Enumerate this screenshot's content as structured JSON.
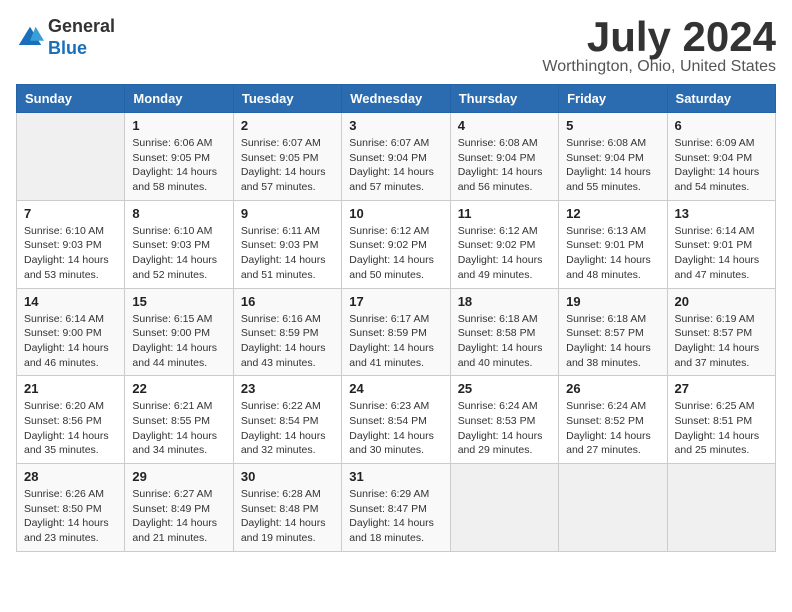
{
  "logo": {
    "general": "General",
    "blue": "Blue"
  },
  "title": "July 2024",
  "location": "Worthington, Ohio, United States",
  "days_of_week": [
    "Sunday",
    "Monday",
    "Tuesday",
    "Wednesday",
    "Thursday",
    "Friday",
    "Saturday"
  ],
  "weeks": [
    [
      {
        "day": "",
        "sunrise": "",
        "sunset": "",
        "daylight": ""
      },
      {
        "day": "1",
        "sunrise": "Sunrise: 6:06 AM",
        "sunset": "Sunset: 9:05 PM",
        "daylight": "Daylight: 14 hours and 58 minutes."
      },
      {
        "day": "2",
        "sunrise": "Sunrise: 6:07 AM",
        "sunset": "Sunset: 9:05 PM",
        "daylight": "Daylight: 14 hours and 57 minutes."
      },
      {
        "day": "3",
        "sunrise": "Sunrise: 6:07 AM",
        "sunset": "Sunset: 9:04 PM",
        "daylight": "Daylight: 14 hours and 57 minutes."
      },
      {
        "day": "4",
        "sunrise": "Sunrise: 6:08 AM",
        "sunset": "Sunset: 9:04 PM",
        "daylight": "Daylight: 14 hours and 56 minutes."
      },
      {
        "day": "5",
        "sunrise": "Sunrise: 6:08 AM",
        "sunset": "Sunset: 9:04 PM",
        "daylight": "Daylight: 14 hours and 55 minutes."
      },
      {
        "day": "6",
        "sunrise": "Sunrise: 6:09 AM",
        "sunset": "Sunset: 9:04 PM",
        "daylight": "Daylight: 14 hours and 54 minutes."
      }
    ],
    [
      {
        "day": "7",
        "sunrise": "Sunrise: 6:10 AM",
        "sunset": "Sunset: 9:03 PM",
        "daylight": "Daylight: 14 hours and 53 minutes."
      },
      {
        "day": "8",
        "sunrise": "Sunrise: 6:10 AM",
        "sunset": "Sunset: 9:03 PM",
        "daylight": "Daylight: 14 hours and 52 minutes."
      },
      {
        "day": "9",
        "sunrise": "Sunrise: 6:11 AM",
        "sunset": "Sunset: 9:03 PM",
        "daylight": "Daylight: 14 hours and 51 minutes."
      },
      {
        "day": "10",
        "sunrise": "Sunrise: 6:12 AM",
        "sunset": "Sunset: 9:02 PM",
        "daylight": "Daylight: 14 hours and 50 minutes."
      },
      {
        "day": "11",
        "sunrise": "Sunrise: 6:12 AM",
        "sunset": "Sunset: 9:02 PM",
        "daylight": "Daylight: 14 hours and 49 minutes."
      },
      {
        "day": "12",
        "sunrise": "Sunrise: 6:13 AM",
        "sunset": "Sunset: 9:01 PM",
        "daylight": "Daylight: 14 hours and 48 minutes."
      },
      {
        "day": "13",
        "sunrise": "Sunrise: 6:14 AM",
        "sunset": "Sunset: 9:01 PM",
        "daylight": "Daylight: 14 hours and 47 minutes."
      }
    ],
    [
      {
        "day": "14",
        "sunrise": "Sunrise: 6:14 AM",
        "sunset": "Sunset: 9:00 PM",
        "daylight": "Daylight: 14 hours and 46 minutes."
      },
      {
        "day": "15",
        "sunrise": "Sunrise: 6:15 AM",
        "sunset": "Sunset: 9:00 PM",
        "daylight": "Daylight: 14 hours and 44 minutes."
      },
      {
        "day": "16",
        "sunrise": "Sunrise: 6:16 AM",
        "sunset": "Sunset: 8:59 PM",
        "daylight": "Daylight: 14 hours and 43 minutes."
      },
      {
        "day": "17",
        "sunrise": "Sunrise: 6:17 AM",
        "sunset": "Sunset: 8:59 PM",
        "daylight": "Daylight: 14 hours and 41 minutes."
      },
      {
        "day": "18",
        "sunrise": "Sunrise: 6:18 AM",
        "sunset": "Sunset: 8:58 PM",
        "daylight": "Daylight: 14 hours and 40 minutes."
      },
      {
        "day": "19",
        "sunrise": "Sunrise: 6:18 AM",
        "sunset": "Sunset: 8:57 PM",
        "daylight": "Daylight: 14 hours and 38 minutes."
      },
      {
        "day": "20",
        "sunrise": "Sunrise: 6:19 AM",
        "sunset": "Sunset: 8:57 PM",
        "daylight": "Daylight: 14 hours and 37 minutes."
      }
    ],
    [
      {
        "day": "21",
        "sunrise": "Sunrise: 6:20 AM",
        "sunset": "Sunset: 8:56 PM",
        "daylight": "Daylight: 14 hours and 35 minutes."
      },
      {
        "day": "22",
        "sunrise": "Sunrise: 6:21 AM",
        "sunset": "Sunset: 8:55 PM",
        "daylight": "Daylight: 14 hours and 34 minutes."
      },
      {
        "day": "23",
        "sunrise": "Sunrise: 6:22 AM",
        "sunset": "Sunset: 8:54 PM",
        "daylight": "Daylight: 14 hours and 32 minutes."
      },
      {
        "day": "24",
        "sunrise": "Sunrise: 6:23 AM",
        "sunset": "Sunset: 8:54 PM",
        "daylight": "Daylight: 14 hours and 30 minutes."
      },
      {
        "day": "25",
        "sunrise": "Sunrise: 6:24 AM",
        "sunset": "Sunset: 8:53 PM",
        "daylight": "Daylight: 14 hours and 29 minutes."
      },
      {
        "day": "26",
        "sunrise": "Sunrise: 6:24 AM",
        "sunset": "Sunset: 8:52 PM",
        "daylight": "Daylight: 14 hours and 27 minutes."
      },
      {
        "day": "27",
        "sunrise": "Sunrise: 6:25 AM",
        "sunset": "Sunset: 8:51 PM",
        "daylight": "Daylight: 14 hours and 25 minutes."
      }
    ],
    [
      {
        "day": "28",
        "sunrise": "Sunrise: 6:26 AM",
        "sunset": "Sunset: 8:50 PM",
        "daylight": "Daylight: 14 hours and 23 minutes."
      },
      {
        "day": "29",
        "sunrise": "Sunrise: 6:27 AM",
        "sunset": "Sunset: 8:49 PM",
        "daylight": "Daylight: 14 hours and 21 minutes."
      },
      {
        "day": "30",
        "sunrise": "Sunrise: 6:28 AM",
        "sunset": "Sunset: 8:48 PM",
        "daylight": "Daylight: 14 hours and 19 minutes."
      },
      {
        "day": "31",
        "sunrise": "Sunrise: 6:29 AM",
        "sunset": "Sunset: 8:47 PM",
        "daylight": "Daylight: 14 hours and 18 minutes."
      },
      {
        "day": "",
        "sunrise": "",
        "sunset": "",
        "daylight": ""
      },
      {
        "day": "",
        "sunrise": "",
        "sunset": "",
        "daylight": ""
      },
      {
        "day": "",
        "sunrise": "",
        "sunset": "",
        "daylight": ""
      }
    ]
  ]
}
